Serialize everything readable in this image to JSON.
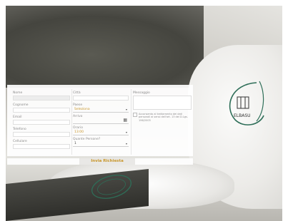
{
  "form": {
    "nome_label": "Nome",
    "cognome_label": "Cognome",
    "email_label": "Email",
    "telefono_label": "Telefono",
    "cellulare_label": "Cellulare",
    "citta_label": "Città",
    "paese_label": "Paese",
    "paese_value": "Seleziona",
    "arrivo_label": "Arrivo",
    "orario_label": "Orario",
    "orario_value": "13:00",
    "persone_label": "Quante Persone?",
    "persone_value": "1",
    "messaggio_label": "Messaggio",
    "consent_text": "Acconsento al trattamento dei dati personali ai sensi dell'art. 13 del D.Lgs. 196/2003",
    "calendar_glyph": "▦",
    "dropdown_glyph": "▾"
  },
  "submit": {
    "label": "Invia Richiesta"
  },
  "brand": {
    "logo_text": "ELBASU",
    "logo_color": "#2e6e58",
    "accent_color": "#c8962a"
  }
}
